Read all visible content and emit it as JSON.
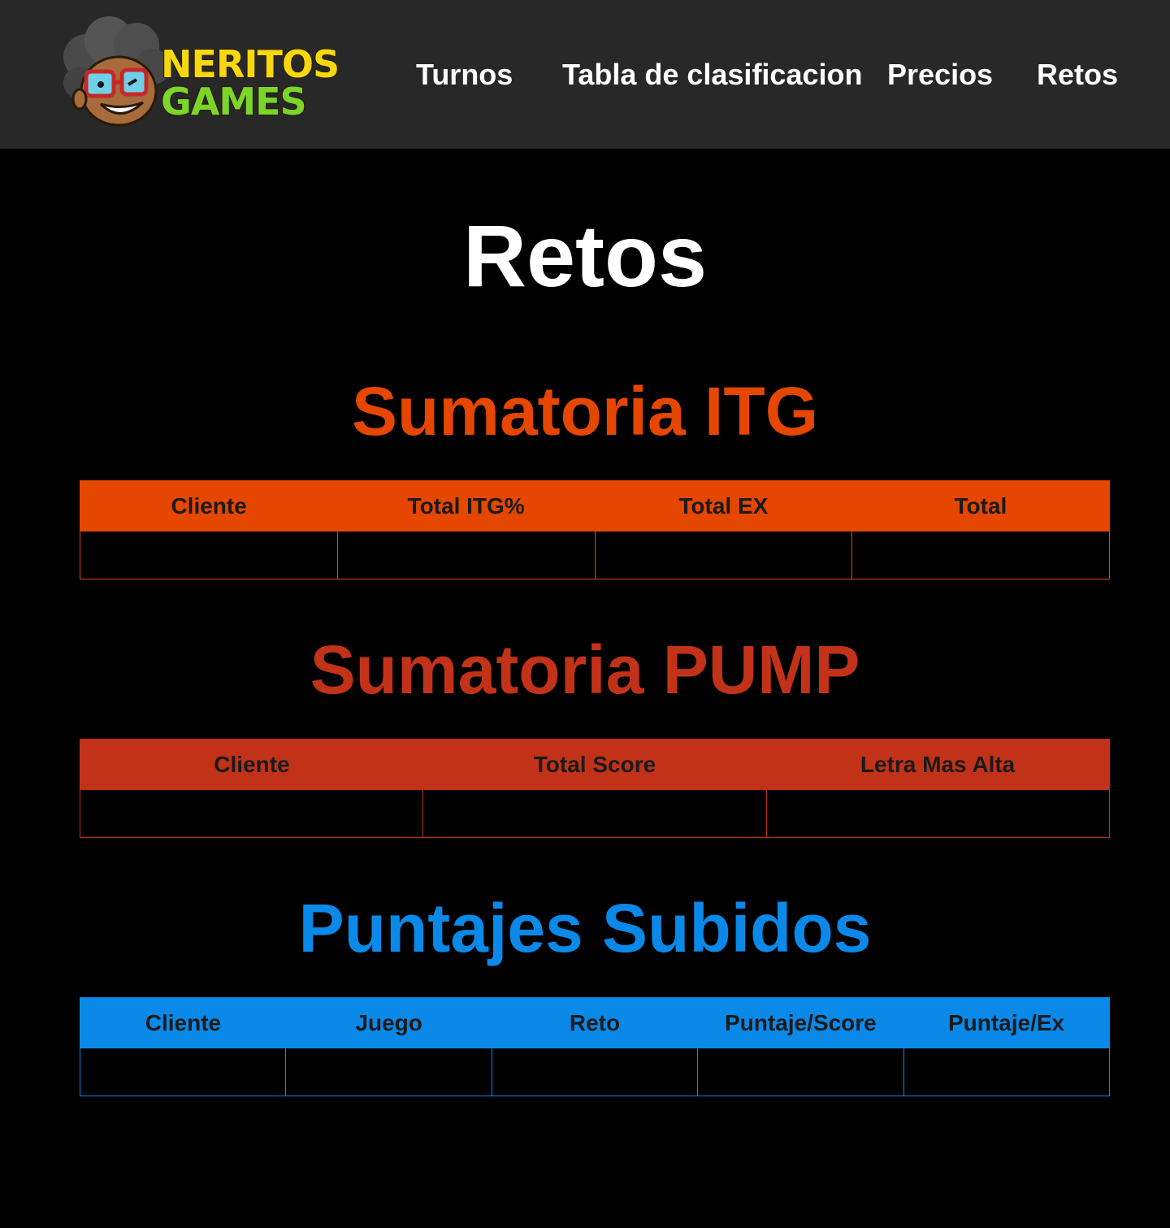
{
  "brand": {
    "line1": "NERITOS",
    "line2": "GAMES"
  },
  "nav": {
    "items": [
      "Turnos",
      "Tabla de clasificacion",
      "Precios",
      "Retos"
    ]
  },
  "page": {
    "title": "Retos"
  },
  "colors": {
    "header_bg": "#282828",
    "page_bg": "#000000",
    "itg": "#e54600",
    "pump": "#c23218",
    "subidos": "#0a89e8"
  },
  "sections": {
    "itg": {
      "title": "Sumatoria ITG",
      "columns": [
        "Cliente",
        "Total ITG%",
        "Total EX",
        "Total"
      ],
      "rows": [
        [
          "",
          "",
          "",
          ""
        ]
      ]
    },
    "pump": {
      "title": "Sumatoria PUMP",
      "columns": [
        "Cliente",
        "Total Score",
        "Letra Mas Alta"
      ],
      "rows": [
        [
          "",
          "",
          ""
        ]
      ]
    },
    "subidos": {
      "title": "Puntajes Subidos",
      "columns": [
        "Cliente",
        "Juego",
        "Reto",
        "Puntaje/Score",
        "Puntaje/Ex"
      ],
      "rows": [
        [
          "",
          "",
          "",
          "",
          ""
        ]
      ]
    }
  }
}
